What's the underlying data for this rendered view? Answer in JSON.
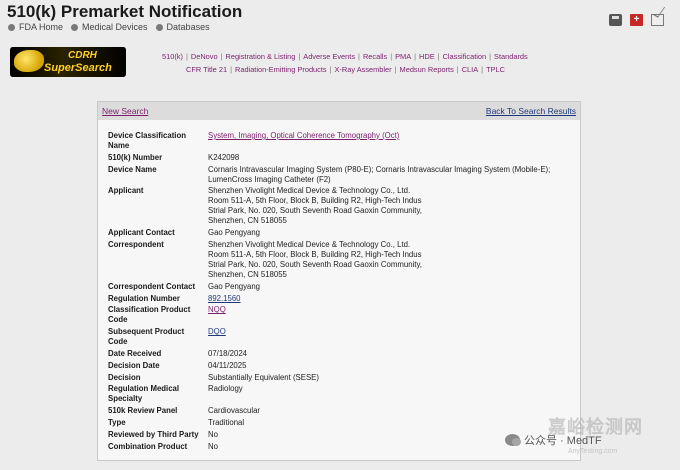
{
  "header": {
    "title": "510(k) Premarket Notification",
    "breadcrumbs": [
      "FDA Home",
      "Medical Devices",
      "Databases"
    ]
  },
  "icons": [
    "printer-icon",
    "plus-icon",
    "email-icon"
  ],
  "logo": {
    "line1": "CDRH",
    "line2": "SuperSearch"
  },
  "nav": {
    "row1": [
      "510(k)",
      "DeNovo",
      "Registration & Listing",
      "Adverse Events",
      "Recalls",
      "PMA",
      "HDE",
      "Classification",
      "Standards"
    ],
    "row2": [
      "CFR Title 21",
      "Radiation-Emitting Products",
      "X-Ray Assembler",
      "Medsun Reports",
      "CLIA",
      "TPLC"
    ]
  },
  "panel": {
    "new_search": "New Search",
    "back_to_results": "Back To Search Results"
  },
  "details": [
    {
      "label": "Device Classification Name",
      "value": "System, Imaging, Optical Coherence Tomography (Oct)",
      "link": "purple"
    },
    {
      "label": "510(k) Number",
      "value": "K242098"
    },
    {
      "label": "Device Name",
      "value": "Cornaris Intravascular Imaging System (P80-E); Cornaris Intravascular Imaging System (Mobile-E); LumenCross Imaging Catheter (F2)"
    },
    {
      "label": "Applicant",
      "lines": [
        "Shenzhen Vivolight Medical Device & Technology Co., Ltd.",
        "Room 511-A, 5th Floor, Block B, Building R2, High-Tech Indus",
        "Strial Park, No. 020, South Seventh Road Gaoxin Community,",
        "Shenzhen,  CN 518055"
      ]
    },
    {
      "label": "Applicant Contact",
      "value": "Gao Pengyang"
    },
    {
      "label": "Correspondent",
      "lines": [
        "Shenzhen Vivolight Medical Device & Technology Co., Ltd.",
        "Room 511-A, 5th Floor, Block B, Building R2, High-Tech Indus",
        "Strial Park, No. 020, South Seventh Road Gaoxin Community,",
        "Shenzhen,  CN 518055"
      ]
    },
    {
      "label": "Correspondent Contact",
      "value": "Gao Pengyang"
    },
    {
      "label": "Regulation Number",
      "value": "892.1560",
      "link": "blue"
    },
    {
      "label": "Classification Product Code",
      "value": "NQQ",
      "link": "purple"
    },
    {
      "label": "Subsequent Product Code",
      "value": "DQO",
      "link": "blue"
    },
    {
      "label": "Date Received",
      "value": "07/18/2024"
    },
    {
      "label": "Decision Date",
      "value": "04/11/2025"
    },
    {
      "label": "Decision",
      "value": "Substantially Equivalent (SESE)"
    },
    {
      "label": "Regulation Medical Specialty",
      "value": "Radiology"
    },
    {
      "label": "510k Review Panel",
      "value": "Cardiovascular"
    },
    {
      "label": "Type",
      "value": "Traditional"
    },
    {
      "label": "Reviewed by Third Party",
      "value": "No"
    },
    {
      "label": "Combination Product",
      "value": "No"
    }
  ],
  "watermark": {
    "wechat": "公众号 · MedTF",
    "site": "嘉峪检测网",
    "site_sub": "AnyTesting.com"
  }
}
